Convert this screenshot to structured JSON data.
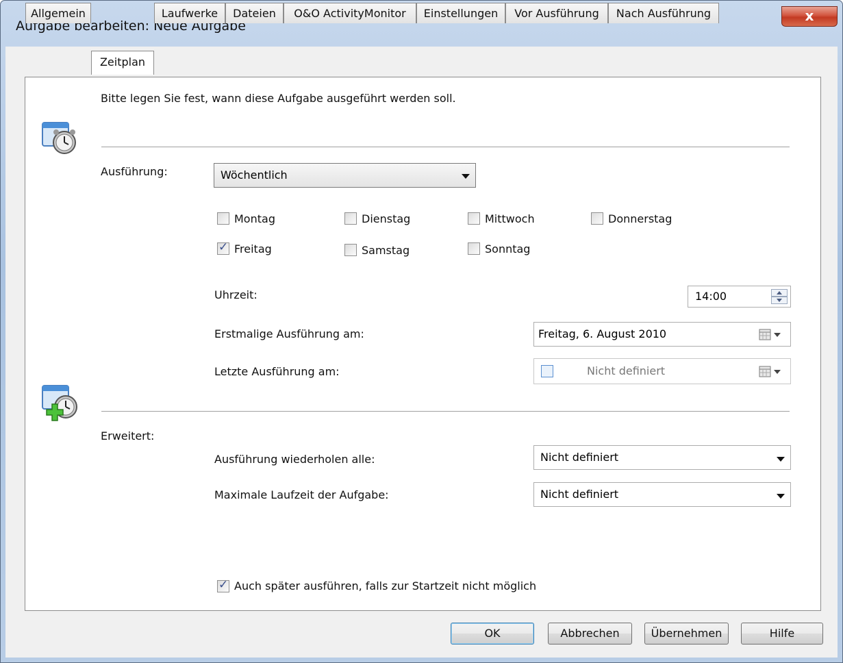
{
  "window": {
    "title": "Aufgabe bearbeiten: Neue Aufgabe",
    "close_label": "x"
  },
  "tabs": [
    "Allgemein",
    "Zeitplan",
    "Laufwerke",
    "Dateien",
    "O&O ActivityMonitor",
    "Einstellungen",
    "Vor Ausführung",
    "Nach Ausführung"
  ],
  "intro_text": "Bitte legen Sie fest, wann diese Aufgabe ausgeführt werden soll.",
  "schedule": {
    "execution_label": "Ausführung:",
    "execution_value": "Wöchentlich",
    "days": [
      {
        "label": "Montag",
        "checked": false
      },
      {
        "label": "Dienstag",
        "checked": false
      },
      {
        "label": "Mittwoch",
        "checked": false
      },
      {
        "label": "Donnerstag",
        "checked": false
      },
      {
        "label": "Freitag",
        "checked": true
      },
      {
        "label": "Samstag",
        "checked": false
      },
      {
        "label": "Sonntag",
        "checked": false
      }
    ],
    "time_label": "Uhrzeit:",
    "time_value": "14:00",
    "first_run_label": "Erstmalige Ausführung am:",
    "first_run_value": "Freitag, 6. August 2010",
    "last_run_label": "Letzte Ausführung am:",
    "last_run_value": "Nicht definiert"
  },
  "advanced": {
    "label": "Erweitert:",
    "repeat_label": "Ausführung wiederholen alle:",
    "repeat_value": "Nicht definiert",
    "max_runtime_label": "Maximale Laufzeit der Aufgabe:",
    "max_runtime_value": "Nicht definiert",
    "run_later_label": "Auch später ausführen, falls zur Startzeit nicht möglich",
    "run_later_checked": true
  },
  "buttons": {
    "ok": "OK",
    "cancel": "Abbrechen",
    "apply": "Übernehmen",
    "help": "Hilfe"
  }
}
